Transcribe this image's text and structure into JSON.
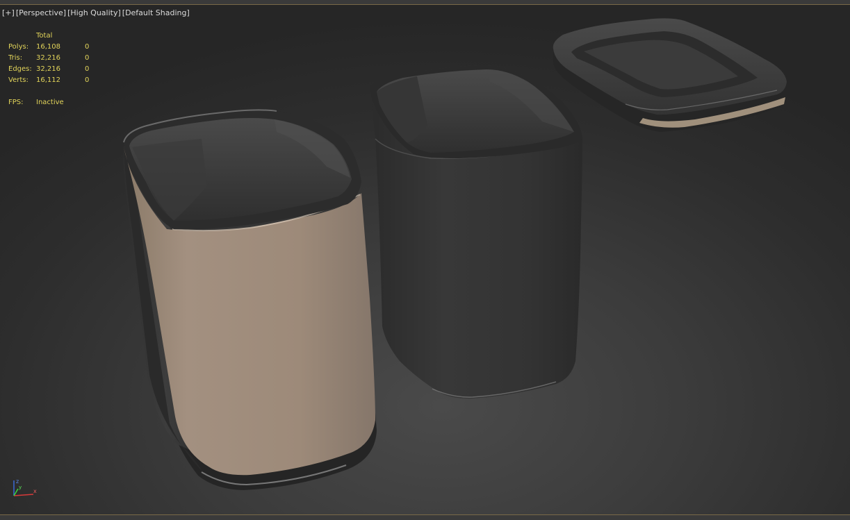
{
  "viewport_label": {
    "plus": "[+]",
    "view": "[Perspective]",
    "quality": "[High Quality]",
    "shading": "[Default Shading]"
  },
  "stats": {
    "header": "Total",
    "rows": [
      {
        "label": "Polys:",
        "total": "16,108",
        "selected": "0"
      },
      {
        "label": "Tris:",
        "total": "32,216",
        "selected": "0"
      },
      {
        "label": "Edges:",
        "total": "32,216",
        "selected": "0"
      },
      {
        "label": "Verts:",
        "total": "16,112",
        "selected": "0"
      }
    ],
    "fps_label": "FPS:",
    "fps_value": "Inactive"
  },
  "gizmo": {
    "z": "z",
    "x": "x",
    "y": "y"
  },
  "colors": {
    "text": "#dcdcdc",
    "stats": "#e2d45a",
    "frame_accent": "#7a6a48",
    "tan_material": "#a4927e",
    "dark_material": "#3a3a3a"
  }
}
